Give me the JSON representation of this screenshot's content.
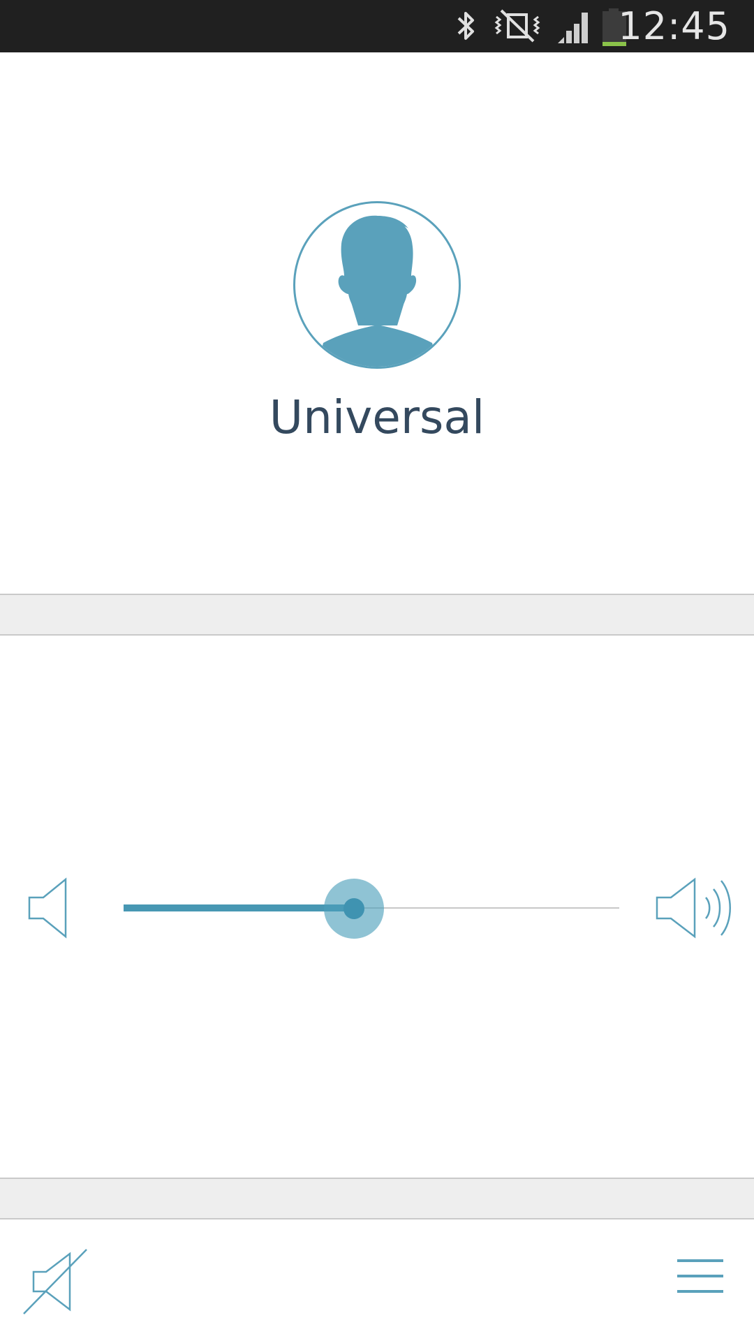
{
  "status_bar": {
    "time": "12:45",
    "icons": [
      "bluetooth-icon",
      "mute-vibrate-icon",
      "signal-icon",
      "battery-icon"
    ],
    "battery_level": 0.12,
    "background_color": "#202020"
  },
  "profile": {
    "name": "Universal",
    "avatar_icon": "person-silhouette-icon",
    "accent_color": "#5aa1bb"
  },
  "volume": {
    "level": 0.465,
    "low_icon": "speaker-low-icon",
    "high_icon": "speaker-high-icon",
    "fill_color": "#4797b3"
  },
  "bottom_bar": {
    "mute_icon": "speaker-muted-icon",
    "menu_icon": "hamburger-menu-icon"
  }
}
